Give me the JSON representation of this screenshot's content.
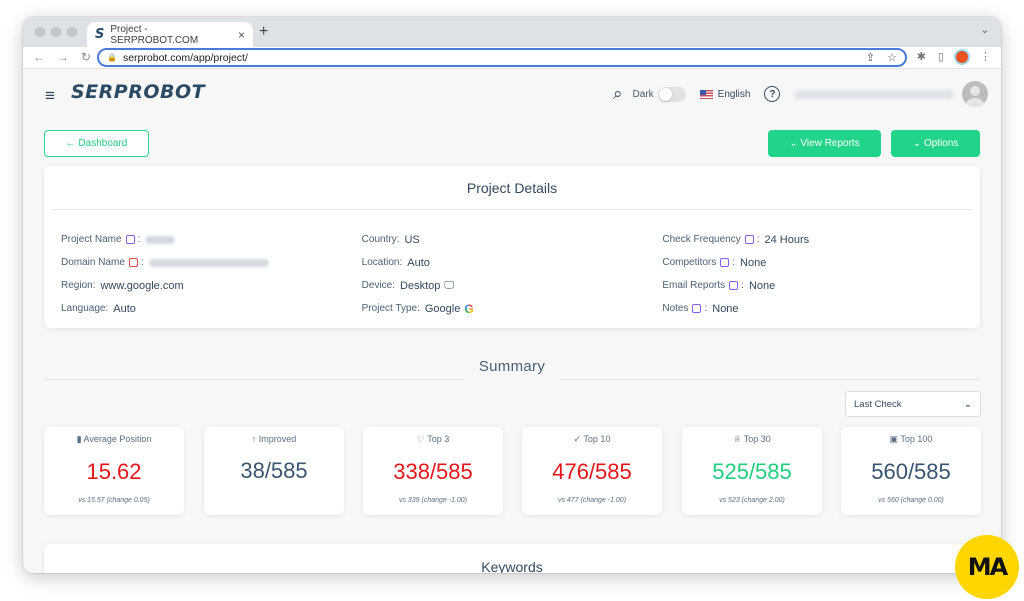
{
  "browser": {
    "tab_title": "Project - SERPROBOT.COM",
    "tab_favicon": "S",
    "new_tab_icon": "+",
    "close_tab_icon": "×",
    "url": "serprobot.com/app/project/"
  },
  "header": {
    "logo": "SERPROBOT",
    "dark_label": "Dark",
    "dark_mode_on": false,
    "language": "English",
    "help_icon": "?"
  },
  "actions": {
    "dashboard": "← Dashboard",
    "view_reports": "⌄ View Reports",
    "options": "⌄ Options"
  },
  "project_details": {
    "title": "Project Details",
    "columns": [
      [
        {
          "label": "Project Name",
          "value": "",
          "edit": "purple",
          "blurred": true
        },
        {
          "label": "Domain Name",
          "value": "",
          "edit": "red",
          "blurred": true
        },
        {
          "label": "Region:",
          "value": "www.google.com"
        },
        {
          "label": "Language:",
          "value": "Auto"
        }
      ],
      [
        {
          "label": "Country:",
          "value": "US"
        },
        {
          "label": "Location:",
          "value": "Auto"
        },
        {
          "label": "Device:",
          "value": "Desktop",
          "icon": "monitor-icon"
        },
        {
          "label": "Project Type:",
          "value": "Google",
          "icon": "google-icon"
        }
      ],
      [
        {
          "label": "Check Frequency",
          "value": "24 Hours",
          "edit": "purple"
        },
        {
          "label": "Competitors",
          "value": "None",
          "edit": "purple"
        },
        {
          "label": "Email Reports",
          "value": "None",
          "edit": "purple"
        },
        {
          "label": "Notes",
          "value": "None",
          "edit": "purple"
        }
      ]
    ]
  },
  "summary": {
    "title": "Summary",
    "period_select": "Last Check",
    "stats": [
      {
        "icon": "bar-chart-icon",
        "glyph": "▮",
        "label": "Average Position",
        "value": "15.62",
        "color": "#e3161c",
        "compare": "vs 15.57 (change 0.05)"
      },
      {
        "icon": "arrow-up-icon",
        "glyph": "↑",
        "label": "Improved",
        "value": "38/585",
        "color": "#3a5570",
        "compare": ""
      },
      {
        "icon": "heart-icon",
        "glyph": "♡",
        "label": "Top 3",
        "value": "338/585",
        "color": "#e3161c",
        "compare": "vs 339 (change -1.00)"
      },
      {
        "icon": "check-icon",
        "glyph": "✓",
        "label": "Top 10",
        "value": "476/585",
        "color": "#e3161c",
        "compare": "vs 477 (change -1.00)"
      },
      {
        "icon": "award-icon",
        "glyph": "♕",
        "label": "Top 30",
        "value": "525/585",
        "color": "#1fcf7f",
        "compare": "vs 523 (change 2.00)"
      },
      {
        "icon": "briefcase-icon",
        "glyph": "▣",
        "label": "Top 100",
        "value": "560/585",
        "color": "#3a5570",
        "compare": "vs 560 (change 0.00)"
      }
    ]
  },
  "keywords": {
    "title": "Keywords"
  },
  "watermark": "MA"
}
